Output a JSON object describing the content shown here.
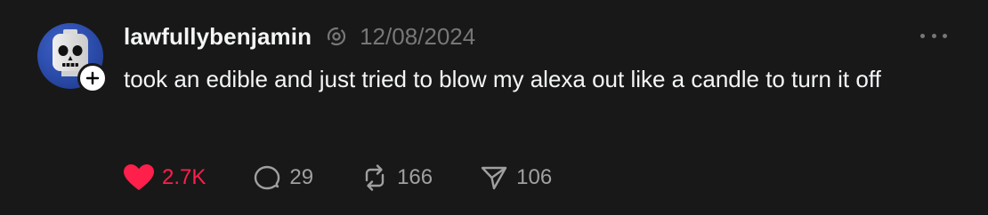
{
  "post": {
    "username": "lawfullybenjamin",
    "timestamp": "12/08/2024",
    "text": "took an edible and just tried to blow my alexa out like a candle to turn it off",
    "likes": "2.7K",
    "replies": "29",
    "reposts": "166",
    "shares": "106"
  },
  "colors": {
    "background": "#181818",
    "text": "#f3f5f7",
    "muted": "#777777",
    "like_active": "#ff1f4b",
    "avatar_bg": "#2a4aa8"
  },
  "icons": {
    "avatar": "skeleton-minifigure-avatar",
    "follow": "plus-icon",
    "ai_label": "ai-info-icon",
    "more": "more-icon",
    "like": "heart-icon",
    "reply": "comment-icon",
    "repost": "repost-icon",
    "share": "send-icon"
  }
}
